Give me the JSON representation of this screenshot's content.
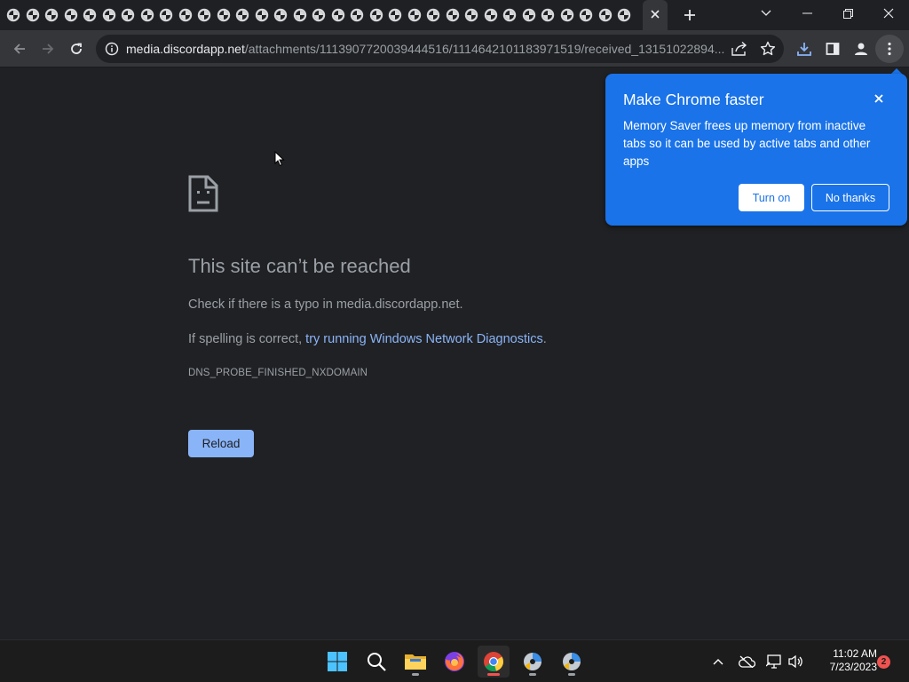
{
  "browser": {
    "tab_count_icons": 33,
    "tab_favicon": "discord-attachment-favicon",
    "toolbar": {
      "back": "back-arrow-icon",
      "forward": "forward-arrow-icon",
      "reload": "reload-icon"
    },
    "omnibox": {
      "url_host": "media.discordapp.net",
      "url_path": "/attachments/1113907720039444516/1114642101183971519/received_13151022894..."
    }
  },
  "error_page": {
    "title": "This site can’t be reached",
    "typo_line": "Check if there is a typo in media.discordapp.net.",
    "spelling_prefix": "If spelling is correct, ",
    "diagnostics_link": "try running Windows Network Diagnostics",
    "spelling_suffix": ".",
    "error_code": "DNS_PROBE_FINISHED_NXDOMAIN",
    "reload_label": "Reload"
  },
  "bubble": {
    "title": "Make Chrome faster",
    "body": "Memory Saver frees up memory from inactive tabs so it can be used by active tabs and other apps",
    "turn_on": "Turn on",
    "no_thanks": "No thanks"
  },
  "taskbar": {
    "time": "11:02 AM",
    "date": "7/23/2023",
    "notification_count": "2"
  },
  "colors": {
    "accent": "#1a73e8",
    "link": "#8ab4f8",
    "page_bg": "#202124"
  }
}
